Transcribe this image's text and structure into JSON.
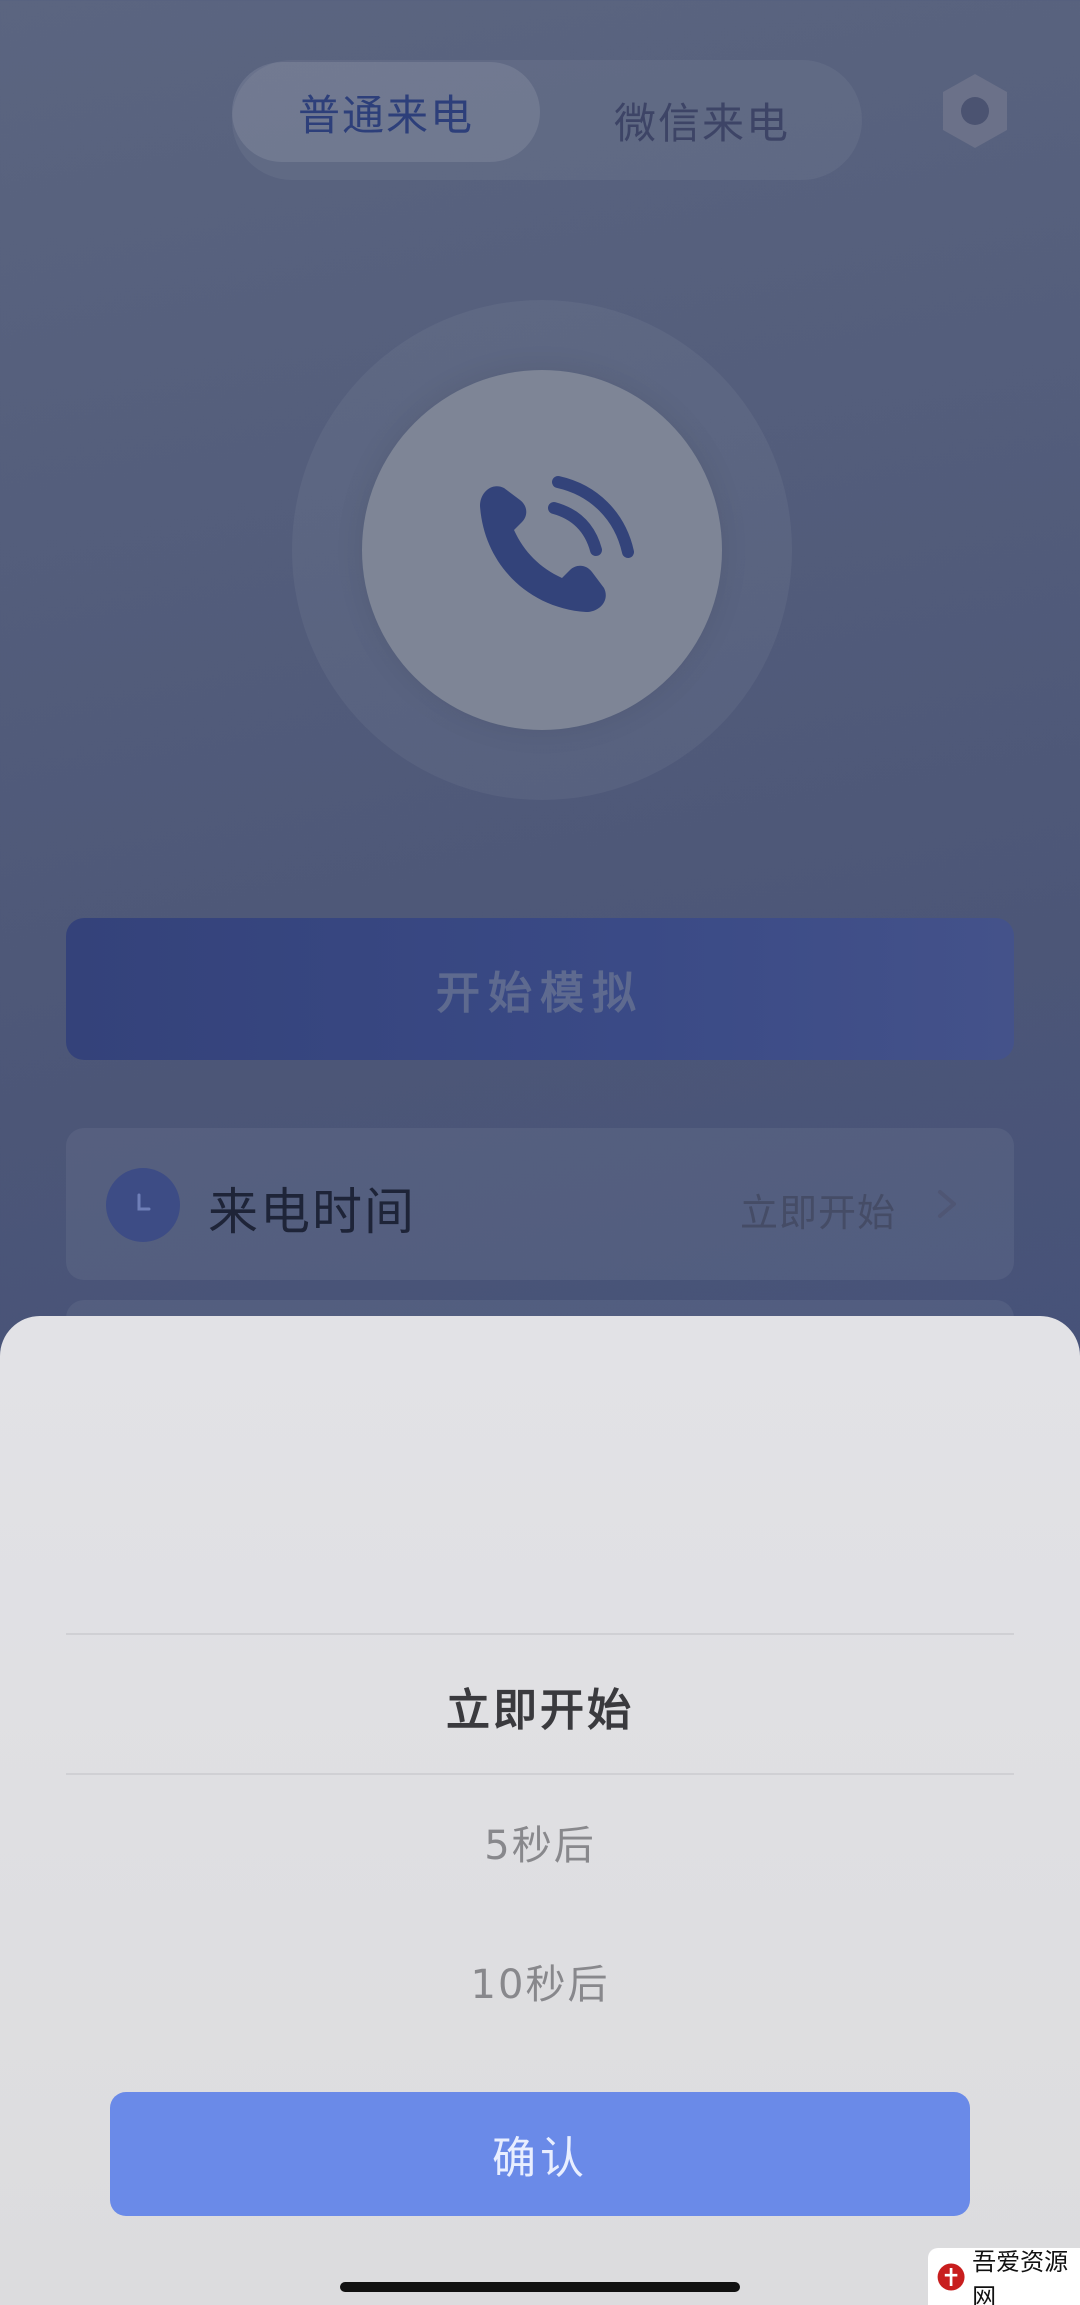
{
  "header": {
    "tabs": [
      {
        "label": "普通来电",
        "active": true
      },
      {
        "label": "微信来电",
        "active": false
      }
    ],
    "settings_icon": "settings-hexagon-icon"
  },
  "call_button": {
    "icon": "phone-ringing-icon"
  },
  "start_button": {
    "label": "开始模拟"
  },
  "settings_rows": [
    {
      "label": "来电时间",
      "value": "立即开始",
      "icon": "clock-icon"
    }
  ],
  "picker_sheet": {
    "options": [
      "立即开始",
      "5秒后",
      "10秒后"
    ],
    "selected": "立即开始",
    "confirm_label": "确认"
  },
  "watermark": {
    "text": "吾爱资源网"
  },
  "colors": {
    "accent": "#6a8ae8",
    "dark_blue": "#2d3f7a",
    "sheet_bg": "#e0e0e3"
  }
}
